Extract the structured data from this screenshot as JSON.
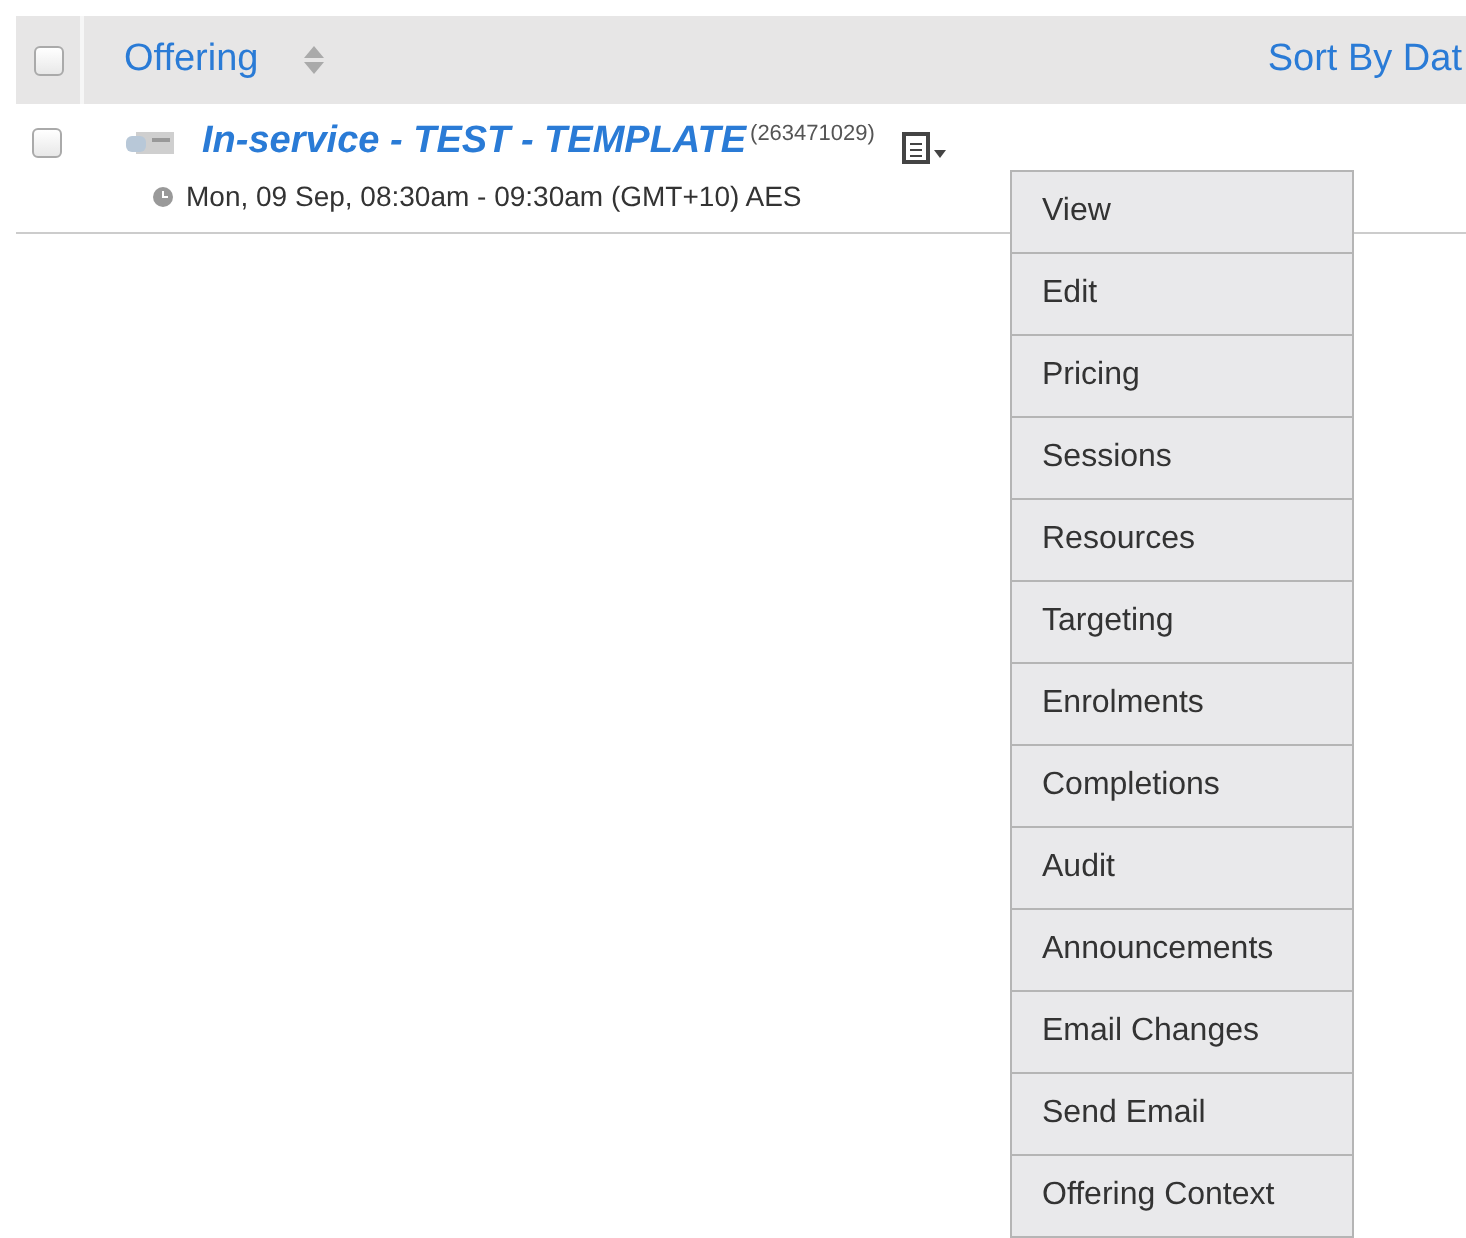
{
  "header": {
    "checked": false,
    "column": "Offering",
    "sort_label": "Sort By Dat"
  },
  "rows": [
    {
      "checked": false,
      "title": "In-service - TEST - TEMPLATE",
      "id": "(263471029)",
      "schedule": "Mon, 09 Sep, 08:30am - 09:30am (GMT+10) AES"
    }
  ],
  "menu": [
    "View",
    "Edit",
    "Pricing",
    "Sessions",
    "Resources",
    "Targeting",
    "Enrolments",
    "Completions",
    "Audit",
    "Announcements",
    "Email Changes",
    "Send Email",
    "Offering Context"
  ]
}
